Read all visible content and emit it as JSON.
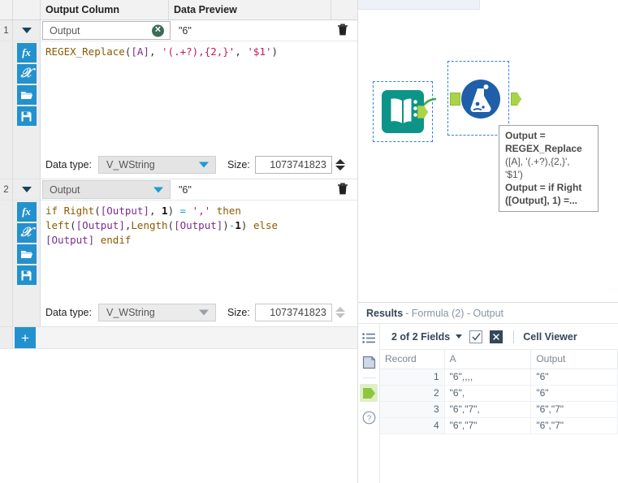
{
  "config": {
    "columns": [
      "",
      "",
      "Output Column",
      "Data Preview",
      ""
    ],
    "rows": [
      {
        "num": "1",
        "output_column": "Output",
        "data_preview": "\"6\"",
        "clear_icon": "clear-circle-icon",
        "delete_icon": "trash-icon",
        "formula_tokens": [
          {
            "t": "REGEX_Replace",
            "c": "k-fn"
          },
          {
            "t": "(",
            "c": "k-brk"
          },
          {
            "t": "[A]",
            "c": "k-fld"
          },
          {
            "t": ", ",
            "c": "k-plain"
          },
          {
            "t": "'(.+?),{2,}'",
            "c": "k-str"
          },
          {
            "t": ", ",
            "c": "k-plain"
          },
          {
            "t": "'$1'",
            "c": "k-str"
          },
          {
            "t": ")",
            "c": "k-brk"
          }
        ],
        "formula_text": "REGEX_Replace([A], '(.+?),{2,}', '$1')",
        "data_type_label": "Data type:",
        "data_type_value": "V_WString",
        "size_label": "Size:",
        "size_value": "1073741823",
        "tools": [
          "fx",
          "X",
          "open-folder",
          "save-disk"
        ]
      },
      {
        "num": "2",
        "output_column": "Output",
        "data_preview": "\"6\"",
        "delete_icon": "trash-icon",
        "formula_lines": [
          [
            {
              "t": "if ",
              "c": "k-kw"
            },
            {
              "t": "Right",
              "c": "k-fn"
            },
            {
              "t": "(",
              "c": "k-brk"
            },
            {
              "t": "[Output]",
              "c": "k-fld"
            },
            {
              "t": ", ",
              "c": "k-plain"
            },
            {
              "t": "1",
              "c": "k-num"
            },
            {
              "t": ")",
              "c": "k-brk"
            },
            {
              "t": " = ",
              "c": "k-op"
            },
            {
              "t": "','",
              "c": "k-str"
            },
            {
              "t": " then",
              "c": "k-kw"
            }
          ],
          [
            {
              "t": "left",
              "c": "k-fn"
            },
            {
              "t": "(",
              "c": "k-brk"
            },
            {
              "t": "[Output]",
              "c": "k-fld"
            },
            {
              "t": ",",
              "c": "k-plain"
            },
            {
              "t": "Length",
              "c": "k-fn"
            },
            {
              "t": "(",
              "c": "k-brk"
            },
            {
              "t": "[Output]",
              "c": "k-fld"
            },
            {
              "t": ")",
              "c": "k-brk"
            },
            {
              "t": "-",
              "c": "k-op"
            },
            {
              "t": "1",
              "c": "k-num"
            },
            {
              "t": ")",
              "c": "k-brk"
            },
            {
              "t": " else",
              "c": "k-kw"
            }
          ],
          [
            {
              "t": "[Output]",
              "c": "k-fld"
            },
            {
              "t": " endif",
              "c": "k-kw"
            }
          ]
        ],
        "formula_text": "if Right([Output], 1) = ',' then left([Output],Length([Output])-1) else [Output] endif",
        "data_type_label": "Data type:",
        "data_type_value": "V_WString",
        "size_label": "Size:",
        "size_value": "1073741823",
        "tools": [
          "fx",
          "X",
          "open-folder",
          "save-disk"
        ]
      }
    ],
    "add_button_label": "+"
  },
  "canvas": {
    "nodes": [
      {
        "name": "input-data-node",
        "icon": "book-icon",
        "selected": true
      },
      {
        "name": "formula-node",
        "icon": "flask-icon",
        "selected": true
      }
    ],
    "tooltip_lines": [
      {
        "text": "Output =",
        "bold": true
      },
      {
        "text": "REGEX_Replace",
        "bold": true
      },
      {
        "text": "([A], '(.+?),{2,}',",
        "bold": false
      },
      {
        "text": "'$1')",
        "bold": false
      },
      {
        "text": "Output = if Right",
        "bold": true
      },
      {
        "text": "([Output], 1) =...",
        "bold": true
      }
    ]
  },
  "results": {
    "title_strong": "Results",
    "title_dim": "- Formula (2) - Output",
    "toolbar": {
      "fields_label": "2 of 2 Fields",
      "check_icon": "checkbox-checked-icon",
      "close_icon": "close-box-icon",
      "cell_viewer_label": "Cell Viewer"
    },
    "rail_icons": [
      "list-icon",
      "metadata-icon",
      "output-anchor-icon",
      "help-icon"
    ],
    "table": {
      "headers": [
        "Record",
        "A",
        "Output"
      ],
      "rows": [
        [
          "1",
          "\"6\",,,,",
          "\"6\""
        ],
        [
          "2",
          "\"6\",",
          "\"6\""
        ],
        [
          "3",
          "\"6\",\"7\",",
          "\"6\",\"7\""
        ],
        [
          "4",
          "\"6\",\"7\"",
          "\"6\",\"7\""
        ]
      ]
    }
  },
  "colors": {
    "accent_blue": "#2391ce",
    "node_teal": "#0d9488",
    "node_navy": "#1f5fa9",
    "anchor_green": "#a9d44a",
    "active_green": "#dff0c8"
  }
}
